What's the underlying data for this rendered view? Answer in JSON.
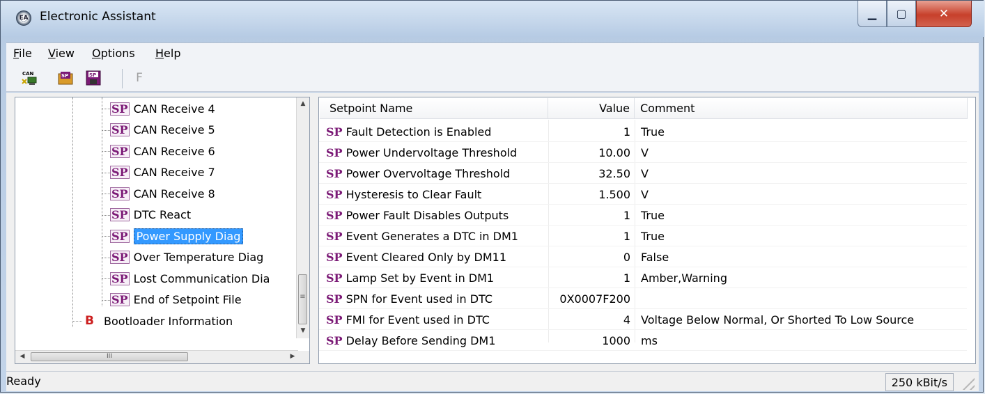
{
  "window": {
    "title": "Electronic Assistant",
    "app_icon": "EA"
  },
  "menu": [
    "File",
    "View",
    "Options",
    "Help"
  ],
  "toolbar": {
    "buttons": [
      "can-connect-icon",
      "sp-open-icon",
      "sp-save-icon",
      "F"
    ],
    "f_label": "F",
    "can_label": "CAN",
    "sp_label": "SP"
  },
  "tree": {
    "items": [
      {
        "label": "CAN Receive 4"
      },
      {
        "label": "CAN Receive 5"
      },
      {
        "label": "CAN Receive 6"
      },
      {
        "label": "CAN Receive 7"
      },
      {
        "label": "CAN Receive 8"
      },
      {
        "label": "DTC React"
      },
      {
        "label": "Power Supply Diag"
      },
      {
        "label": "Over Temperature Diag"
      },
      {
        "label": "Lost Communication Dia"
      },
      {
        "label": "End of Setpoint File"
      }
    ],
    "sp_icon": "SP",
    "bootloader": {
      "icon": "B",
      "label": "Bootloader Information"
    },
    "scroll": {
      "h_thumb_grip": "III",
      "up_arrow": "▲",
      "down_arrow": "▼",
      "left_arrow": "◀",
      "right_arrow": "▶",
      "v_thumb_grip": "≡"
    }
  },
  "table": {
    "columns": [
      "Setpoint Name",
      "Value",
      "Comment"
    ],
    "sp_icon": "SP",
    "rows": [
      {
        "name": "Fault Detection is Enabled",
        "value": "1",
        "comment": "True"
      },
      {
        "name": "Power Undervoltage Threshold",
        "value": "10.00",
        "comment": "V"
      },
      {
        "name": "Power Overvoltage Threshold",
        "value": "32.50",
        "comment": "V"
      },
      {
        "name": "Hysteresis to Clear Fault",
        "value": "1.500",
        "comment": "V"
      },
      {
        "name": "Power Fault Disables Outputs",
        "value": "1",
        "comment": "True"
      },
      {
        "name": "Event Generates a DTC in DM1",
        "value": "1",
        "comment": "True"
      },
      {
        "name": "Event Cleared Only by DM11",
        "value": "0",
        "comment": "False"
      },
      {
        "name": "Lamp Set by Event in DM1",
        "value": "1",
        "comment": "Amber,Warning"
      },
      {
        "name": "SPN for Event used in DTC",
        "value": "0X0007F200",
        "comment": ""
      },
      {
        "name": "FMI for Event used in DTC",
        "value": "4",
        "comment": "Voltage Below Normal, Or Shorted To Low Source"
      },
      {
        "name": "Delay Before Sending DM1",
        "value": "1000",
        "comment": "ms"
      }
    ]
  },
  "status": {
    "text": "Ready",
    "rate": "250 kBit/s"
  },
  "colors": {
    "selection": "#3399ff",
    "sp_icon": "#7b1a76",
    "bootloader_icon": "#cc1f1f"
  }
}
